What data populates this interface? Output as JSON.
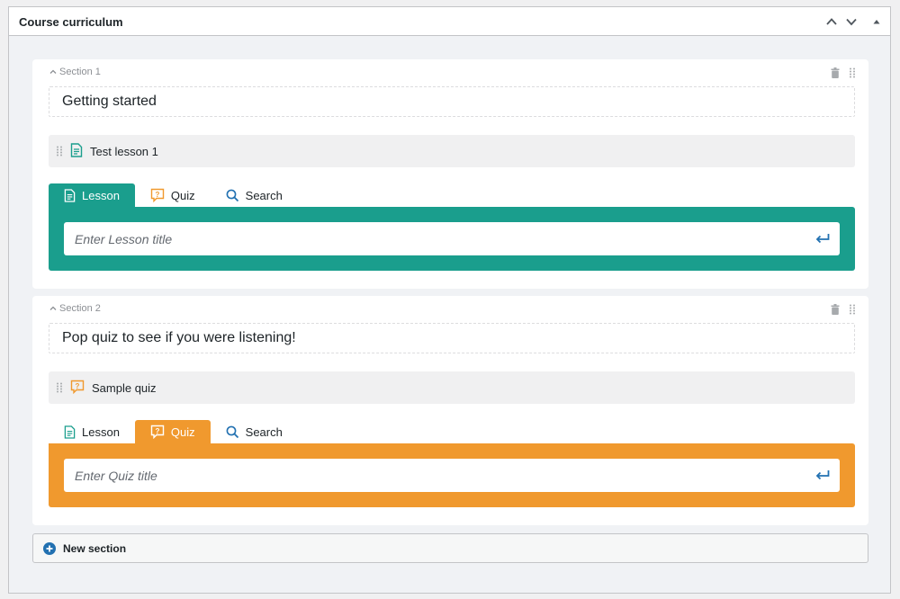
{
  "panel": {
    "title": "Course curriculum"
  },
  "sections": [
    {
      "label": "Section 1",
      "title": "Getting started",
      "items": [
        {
          "type": "lesson",
          "title": "Test lesson 1"
        }
      ],
      "tabs": {
        "lesson": "Lesson",
        "quiz": "Quiz",
        "search": "Search"
      },
      "active_tab": "lesson",
      "input_placeholder": "Enter Lesson title"
    },
    {
      "label": "Section 2",
      "title": "Pop quiz to see if you were listening!",
      "items": [
        {
          "type": "quiz",
          "title": "Sample quiz"
        }
      ],
      "tabs": {
        "lesson": "Lesson",
        "quiz": "Quiz",
        "search": "Search"
      },
      "active_tab": "quiz",
      "input_placeholder": "Enter Quiz title"
    }
  ],
  "new_section_label": "New section",
  "colors": {
    "lesson_accent": "#1a9e8d",
    "quiz_accent": "#f0992e",
    "search_icon": "#2271b1",
    "new_section_icon": "#2271b1"
  },
  "icons": {
    "collapse_up": "chevron-up-icon",
    "collapse_down": "chevron-down-icon",
    "toggle": "triangle-up-icon",
    "delete": "trash-icon",
    "drag": "drag-handle-icon",
    "lesson": "document-icon",
    "quiz": "quiz-bubble-icon",
    "search": "search-icon",
    "enter": "enter-arrow-icon",
    "add": "plus-circle-icon"
  }
}
